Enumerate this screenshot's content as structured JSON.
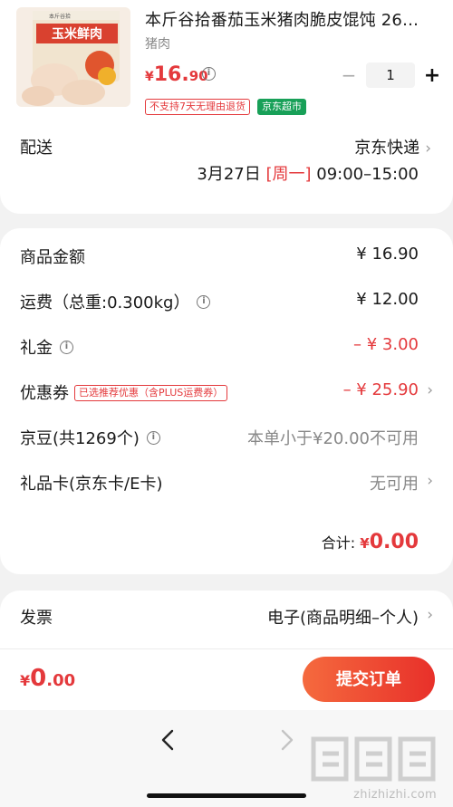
{
  "product": {
    "title": "本斤谷拾番茄玉米猪肉脆皮馄饨 26…",
    "spec": "猪肉",
    "price_symbol": "¥",
    "price_int": "16.",
    "price_dec": "90",
    "quantity": "1",
    "tag_return": "不支持7天无理由退货",
    "tag_store": "京东超市",
    "thumb_text": "玉米鲜肉",
    "thumb_brand": "本斤谷拾"
  },
  "shipping": {
    "label": "配送",
    "carrier": "京东快递",
    "date": "3月27日",
    "weekday": "[周一]",
    "time": "09:00–15:00"
  },
  "summary": {
    "goods_label": "商品金额",
    "goods_value": "¥ 16.90",
    "freight_label": "运费（总重:0.300kg）",
    "freight_value": "¥ 12.00",
    "gift_label": "礼金",
    "gift_value": "– ¥ 3.00",
    "coupon_label": "优惠券",
    "coupon_tag": "已选推荐优惠（含PLUS运费券）",
    "coupon_value": "– ¥ 25.90",
    "beans_label": "京豆(共1269个)",
    "beans_value": "本单小于¥20.00不可用",
    "giftcard_label": "礼品卡(京东卡/E卡)",
    "giftcard_value": "无可用",
    "total_label": "合计:",
    "total_symbol": "¥",
    "total_value": "0.00"
  },
  "invoice": {
    "label": "发票",
    "value": "电子(商品明细–个人)"
  },
  "bottom": {
    "symbol": "¥",
    "int": "0",
    "dec": ".00",
    "submit_label": "提交订单"
  },
  "watermark": {
    "text": "zhizhizhi.com"
  },
  "colors": {
    "accent": "#e4393c",
    "store_green": "#18a058"
  }
}
